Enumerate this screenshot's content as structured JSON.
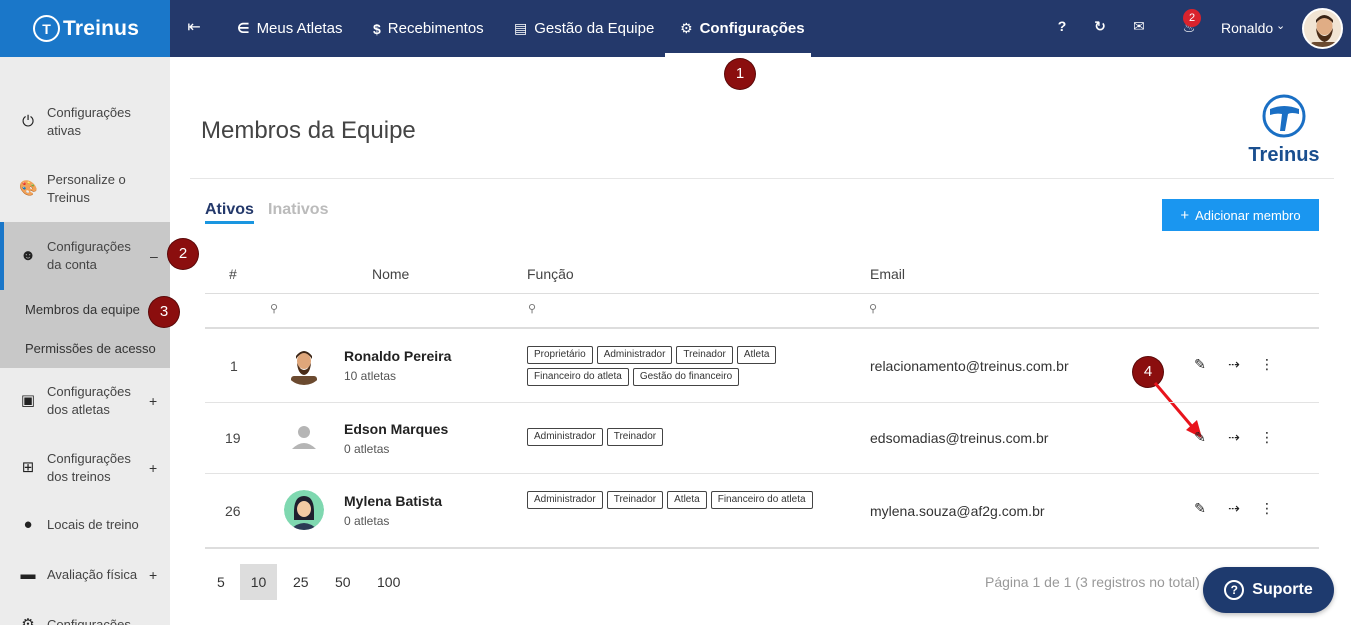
{
  "brand": {
    "name": "Treinus"
  },
  "topnav": {
    "items": [
      {
        "label": "Meus Atletas",
        "icon": "medal-icon"
      },
      {
        "label": "Recebimentos",
        "icon": "dollar-icon"
      },
      {
        "label": "Gestão da Equipe",
        "icon": "contact-card-icon"
      },
      {
        "label": "Configurações",
        "icon": "gears-icon",
        "active": true
      }
    ],
    "help": "?",
    "notifications_count": "2",
    "user_name": "Ronaldo"
  },
  "sidebar": {
    "items": [
      {
        "label": "Configurações ativas",
        "icon": "power-icon"
      },
      {
        "label": "Personalize o Treinus",
        "icon": "palette-icon"
      },
      {
        "label": "Configurações da conta",
        "icon": "user-circle-icon",
        "toggle": "–",
        "active": true
      },
      {
        "label": "Configurações dos atletas",
        "icon": "id-badge-icon",
        "toggle": "+"
      },
      {
        "label": "Configurações dos treinos",
        "icon": "table-gear-icon",
        "toggle": "+"
      },
      {
        "label": "Locais de treino",
        "icon": "map-pin-icon"
      },
      {
        "label": "Avaliação física",
        "icon": "ruler-icon",
        "toggle": "+"
      },
      {
        "label": "Configurações",
        "icon": "gear-icon"
      }
    ],
    "subitems": [
      {
        "label": "Membros da equipe"
      },
      {
        "label": "Permissões de acesso"
      }
    ]
  },
  "markers": [
    "1",
    "2",
    "3",
    "4"
  ],
  "page": {
    "title": "Membros da Equipe",
    "tabs": [
      {
        "label": "Ativos",
        "active": true
      },
      {
        "label": "Inativos"
      }
    ],
    "add_button": "Adicionar membro"
  },
  "table": {
    "headers": {
      "num": "#",
      "name": "Nome",
      "role": "Função",
      "email": "Email"
    },
    "rows": [
      {
        "num": "1",
        "name": "Ronaldo Pereira",
        "athletes": "10 atletas",
        "roles": [
          "Proprietário",
          "Administrador",
          "Treinador",
          "Atleta",
          "Financeiro do atleta",
          "Gestão do financeiro"
        ],
        "email": "relacionamento@treinus.com.br"
      },
      {
        "num": "19",
        "name": "Edson Marques",
        "athletes": "0 atletas",
        "roles": [
          "Administrador",
          "Treinador"
        ],
        "email": "edsomadias@treinus.com.br"
      },
      {
        "num": "26",
        "name": "Mylena Batista",
        "athletes": "0 atletas",
        "roles": [
          "Administrador",
          "Treinador",
          "Atleta",
          "Financeiro do atleta"
        ],
        "email": "mylena.souza@af2g.com.br"
      }
    ]
  },
  "pagination": {
    "sizes": [
      "5",
      "10",
      "25",
      "50",
      "100"
    ],
    "active_size": "10",
    "info": "Página 1 de 1 (3 registros no total)"
  },
  "support": {
    "label": "Suporte"
  },
  "colors": {
    "topbar": "#24396b",
    "brand_blue": "#1a77c9",
    "primary": "#1a96f0",
    "marker": "#8b0e0e"
  }
}
